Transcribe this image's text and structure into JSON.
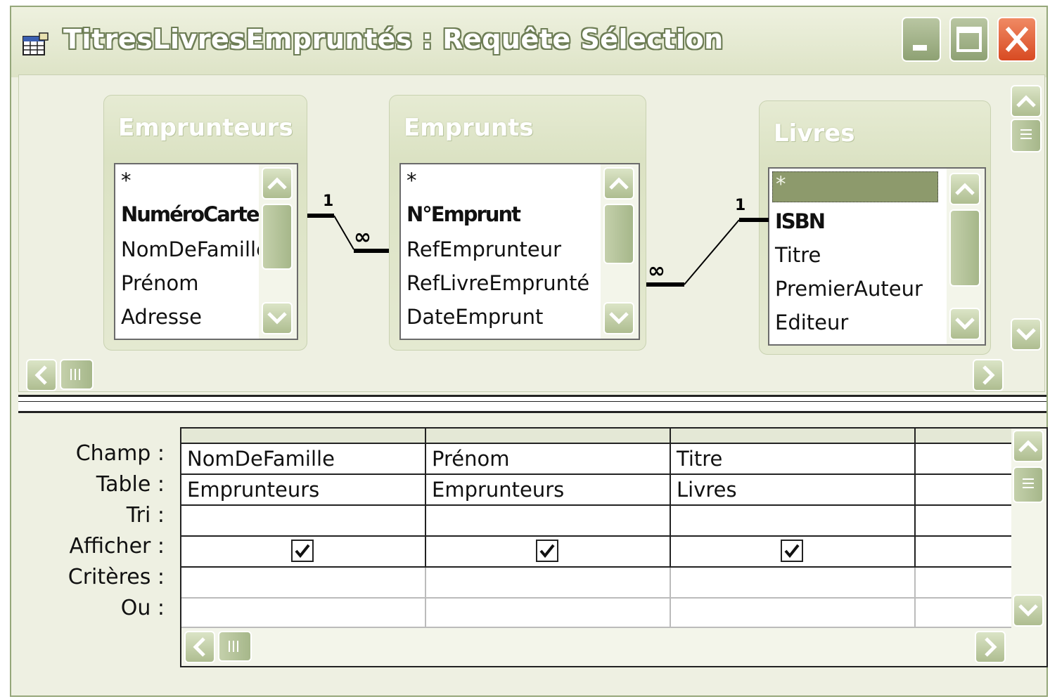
{
  "window": {
    "title": "TitresLivresEmpruntés : Requête Sélection",
    "accent": "#95a77a",
    "close_color": "#d84a22"
  },
  "titlebar_buttons": {
    "minimize": "minimize-icon",
    "maximize": "maximize-icon",
    "close": "close-icon"
  },
  "tables": [
    {
      "name": "Emprunteurs",
      "fields": [
        "*",
        "NuméroCarte",
        "NomDeFamille",
        "Prénom",
        "Adresse"
      ],
      "key_field": "NuméroCarte"
    },
    {
      "name": "Emprunts",
      "fields": [
        "*",
        "N°Emprunt",
        "RefEmprunteur",
        "RefLivreEmprunté",
        "DateEmprunt"
      ],
      "key_field": "N°Emprunt"
    },
    {
      "name": "Livres",
      "fields": [
        "*",
        "ISBN",
        "Titre",
        "PremierAuteur",
        "Editeur"
      ],
      "key_field": "ISBN",
      "selected_field": "*"
    }
  ],
  "relations": [
    {
      "from": "Emprunteurs.NuméroCarte",
      "to": "Emprunts.RefEmprunteur",
      "one": "1",
      "many": "∞"
    },
    {
      "from": "Livres.ISBN",
      "to": "Emprunts.RefLivreEmprunté",
      "one": "1",
      "many": "∞"
    }
  ],
  "grid": {
    "row_labels": [
      "Champ :",
      "Table :",
      "Tri :",
      "Afficher :",
      "Critères :",
      "Ou :"
    ],
    "columns": [
      {
        "champ": "NomDeFamille",
        "table": "Emprunteurs",
        "tri": "",
        "afficher": true,
        "criteres": "",
        "ou": ""
      },
      {
        "champ": "Prénom",
        "table": "Emprunteurs",
        "tri": "",
        "afficher": true,
        "criteres": "",
        "ou": ""
      },
      {
        "champ": "Titre",
        "table": "Livres",
        "tri": "",
        "afficher": true,
        "criteres": "",
        "ou": ""
      },
      {
        "champ": "",
        "table": "",
        "tri": "",
        "afficher": false,
        "criteres": "",
        "ou": ""
      }
    ]
  }
}
